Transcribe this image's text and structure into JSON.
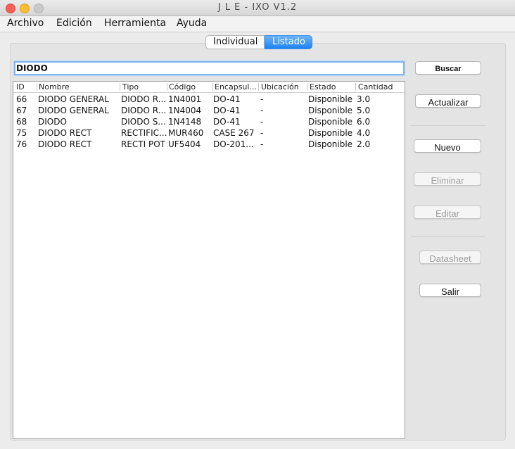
{
  "window": {
    "title": "J L E - IXO V1.2"
  },
  "menu": {
    "items": [
      "Archivo",
      "Edición",
      "Herramienta",
      "Ayuda"
    ]
  },
  "tabs": {
    "individual": "Individual",
    "listado": "Listado",
    "active": "Listado"
  },
  "search": {
    "value": "DIODO"
  },
  "table": {
    "columns": [
      "ID",
      "Nombre",
      "Tipo",
      "Código",
      "Encapsul...",
      "Ubicación",
      "Estado",
      "Cantidad"
    ],
    "rows": [
      [
        "66",
        "DIODO GENERAL",
        "DIODO R...",
        "1N4001",
        "DO-41",
        "-",
        "Disponible",
        "3.0"
      ],
      [
        "67",
        "DIODO GENERAL",
        "DIODO R...",
        "1N4004",
        "DO-41",
        "-",
        "Disponible",
        "5.0"
      ],
      [
        "68",
        "DIODO",
        "DIODO S...",
        "1N4148",
        "DO-41",
        "-",
        "Disponible",
        "6.0"
      ],
      [
        "75",
        "DIODO RECT",
        "RECTIFIC...",
        "MUR460",
        "CASE 267",
        "-",
        "Disponible",
        "4.0"
      ],
      [
        "76",
        "DIODO RECT",
        "RECTI POT",
        "UF5404",
        "DO-201...",
        "-",
        "Disponible",
        "2.0"
      ]
    ]
  },
  "buttons": {
    "buscar": "Buscar",
    "actualizar": "Actualizar",
    "nuevo": "Nuevo",
    "eliminar": "Eliminar",
    "editar": "Editar",
    "datasheet": "Datasheet",
    "salir": "Salir"
  },
  "colors": {
    "accent": "#1c83f0",
    "close": "#fc5f57",
    "minimize": "#fdbd2e"
  }
}
